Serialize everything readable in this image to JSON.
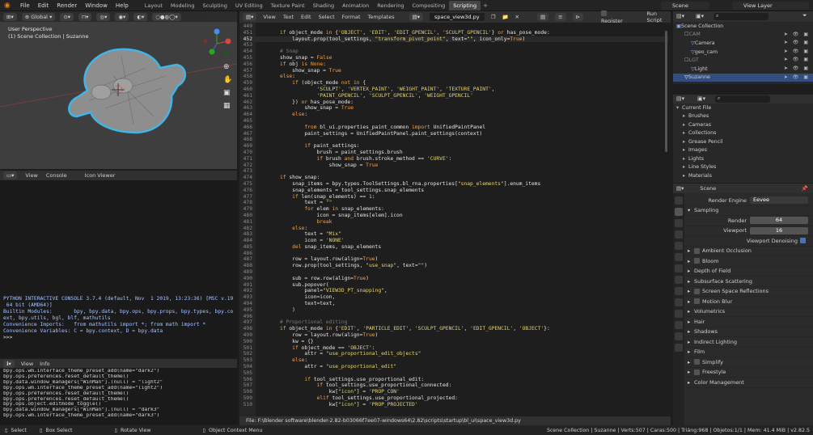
{
  "menu": [
    "File",
    "Edit",
    "Render",
    "Window",
    "Help"
  ],
  "workspaces": [
    "Layout",
    "Modeling",
    "Sculpting",
    "UV Editing",
    "Texture Paint",
    "Shading",
    "Animation",
    "Rendering",
    "Compositing",
    "Scripting"
  ],
  "scene": "Scene",
  "view_layer": "View Layer",
  "viewport": {
    "orientation": "Global",
    "title": "User Perspective",
    "collection": "(1) Scene Collection | Suzanne"
  },
  "console_header": {
    "view": "View",
    "console": "Console",
    "icon_viewer": "Icon Viewer"
  },
  "console_lines": [
    "PYTHON INTERACTIVE CONSOLE 3.7.4 (default, Nov  1 2019, 13:23:36) [MSC v.1916",
    " 64 bit (AMD64)]",
    "",
    "Builtin Modules:       bpy, bpy.data, bpy.ops, bpy.props, bpy.types, bpy.cont",
    "ext, bpy.utils, bgl, blf, mathutils",
    "Convenience Imports:   from mathutils import *; from math import *",
    "Convenience Variables: C = bpy.context, D = bpy.data",
    "",
    ">>> "
  ],
  "info_header": {
    "view": "View",
    "info": "Info"
  },
  "info_lines": [
    "bpy.ops.wm.interface_theme_preset_add(name=\"dark2\")",
    "bpy.ops.preferences.reset_default_theme()",
    "bpy.data.window_managers[\"WinMan\"].(null) = \"light2\"",
    "bpy.ops.wm.interface_theme_preset_add(name=\"light2\")",
    "bpy.ops.preferences.reset_default_theme()",
    "bpy.ops.preferences.reset_default_theme()",
    "bpy.ops.object.editmode_toggle()",
    "bpy.data.window_managers[\"WinMan\"].(null) = \"dark3\"",
    "bpy.ops.wm.interface_theme_preset_add(name=\"dark3\")"
  ],
  "text_editor": {
    "menus": [
      "View",
      "Text",
      "Edit",
      "Select",
      "Format",
      "Templates"
    ],
    "filename": "space_view3d.py",
    "register": "Register",
    "run": "Run Script",
    "footer": "File: F:\\Blender software\\blender-2.82-b03066f7ee07-windows64\\2.82\\scripts\\startup\\bl_ui\\space_view3d.py"
  },
  "code": [
    {
      "n": "449",
      "t": ""
    },
    {
      "n": "451",
      "t": "if object_mode in {'OBJECT', 'EDIT', 'EDIT_GPENCIL', 'SCULPT_GPENCIL'} or has_pose_mode:"
    },
    {
      "n": "452",
      "t": "    layout.prop(tool_settings, \"transform_pivot_point\", text=\"\", icon_only=True)"
    },
    {
      "n": "453",
      "t": ""
    },
    {
      "n": "454",
      "t": "# Snap"
    },
    {
      "n": "455",
      "t": "show_snap = False"
    },
    {
      "n": "456",
      "t": "if obj is None:"
    },
    {
      "n": "457",
      "t": "    show_snap = True"
    },
    {
      "n": "458",
      "t": "else:"
    },
    {
      "n": "459",
      "t": "    if (object_mode not in {"
    },
    {
      "n": "460",
      "t": "            'SCULPT', 'VERTEX_PAINT', 'WEIGHT_PAINT', 'TEXTURE_PAINT',"
    },
    {
      "n": "461",
      "t": "            'PAINT_GPENCIL', 'SCULPT_GPENCIL', 'WEIGHT_GPENCIL'"
    },
    {
      "n": "462",
      "t": "    }) or has_pose_mode:"
    },
    {
      "n": "463",
      "t": "        show_snap = True"
    },
    {
      "n": "464",
      "t": "    else:"
    },
    {
      "n": "465",
      "t": ""
    },
    {
      "n": "466",
      "t": "        from bl_ui.properties_paint_common import UnifiedPaintPanel"
    },
    {
      "n": "467",
      "t": "        paint_settings = UnifiedPaintPanel.paint_settings(context)"
    },
    {
      "n": "468",
      "t": ""
    },
    {
      "n": "469",
      "t": "        if paint_settings:"
    },
    {
      "n": "470",
      "t": "            brush = paint_settings.brush"
    },
    {
      "n": "471",
      "t": "            if brush and brush.stroke_method == 'CURVE':"
    },
    {
      "n": "472",
      "t": "                show_snap = True"
    },
    {
      "n": "473",
      "t": ""
    },
    {
      "n": "474",
      "t": "if show_snap:"
    },
    {
      "n": "475",
      "t": "    snap_items = bpy.types.ToolSettings.bl_rna.properties[\"snap_elements\"].enum_items"
    },
    {
      "n": "476",
      "t": "    snap_elements = tool_settings.snap_elements"
    },
    {
      "n": "477",
      "t": "    if len(snap_elements) == 1:"
    },
    {
      "n": "478",
      "t": "        text = \"\""
    },
    {
      "n": "479",
      "t": "        for elem in snap_elements:"
    },
    {
      "n": "480",
      "t": "            icon = snap_items[elem].icon"
    },
    {
      "n": "481",
      "t": "            break"
    },
    {
      "n": "482",
      "t": "    else:"
    },
    {
      "n": "483",
      "t": "        text = \"Mix\""
    },
    {
      "n": "484",
      "t": "        icon = 'NONE'"
    },
    {
      "n": "485",
      "t": "    del snap_items, snap_elements"
    },
    {
      "n": "486",
      "t": ""
    },
    {
      "n": "487",
      "t": "    row = layout.row(align=True)"
    },
    {
      "n": "488",
      "t": "    row.prop(tool_settings, \"use_snap\", text=\"\")"
    },
    {
      "n": "489",
      "t": ""
    },
    {
      "n": "490",
      "t": "    sub = row.row(align=True)"
    },
    {
      "n": "491",
      "t": "    sub.popover("
    },
    {
      "n": "492",
      "t": "        panel=\"VIEW3D_PT_snapping\","
    },
    {
      "n": "493",
      "t": "        icon=icon,"
    },
    {
      "n": "494",
      "t": "        text=text,"
    },
    {
      "n": "495",
      "t": "    )"
    },
    {
      "n": "496",
      "t": ""
    },
    {
      "n": "497",
      "t": "# Proportional editing"
    },
    {
      "n": "498",
      "t": "if object_mode in {'EDIT', 'PARTICLE_EDIT', 'SCULPT_GPENCIL', 'EDIT_GPENCIL', 'OBJECT'}:"
    },
    {
      "n": "499",
      "t": "    row = layout.row(align=True)"
    },
    {
      "n": "500",
      "t": "    kw = {}"
    },
    {
      "n": "501",
      "t": "    if object_mode == 'OBJECT':"
    },
    {
      "n": "502",
      "t": "        attr = \"use_proportional_edit_objects\""
    },
    {
      "n": "503",
      "t": "    else:"
    },
    {
      "n": "504",
      "t": "        attr = \"use_proportional_edit\""
    },
    {
      "n": "505",
      "t": ""
    },
    {
      "n": "506",
      "t": "        if tool_settings.use_proportional_edit:"
    },
    {
      "n": "507",
      "t": "            if tool_settings.use_proportional_connected:"
    },
    {
      "n": "508",
      "t": "                kw[\"icon\"] = 'PROP_CON'"
    },
    {
      "n": "509",
      "t": "            elif tool_settings.use_proportional_projected:"
    },
    {
      "n": "510",
      "t": "                kw[\"icon\"] = 'PROP_PROJECTED'"
    }
  ],
  "outliner": [
    {
      "label": "Scene Collection",
      "indent": 4
    },
    {
      "label": "CAM",
      "indent": 14,
      "dim": true
    },
    {
      "label": "Camera",
      "indent": 22
    },
    {
      "label": "geo_cam",
      "indent": 22
    },
    {
      "label": "LGT",
      "indent": 14,
      "dim": true
    },
    {
      "label": "Light",
      "indent": 22
    },
    {
      "label": "Suzanne",
      "indent": 14,
      "sel": true
    }
  ],
  "file_browser": {
    "root": "Current File",
    "items": [
      "Brushes",
      "Cameras",
      "Collections",
      "Grease Pencil",
      "Images",
      "Lights",
      "Line Styles",
      "Materials"
    ]
  },
  "properties": {
    "scene_label": "Scene",
    "render_engine_label": "Render Engine",
    "render_engine": "Eevee",
    "sampling": "Sampling",
    "render_label": "Render",
    "render_value": "64",
    "viewport_label": "Viewport",
    "viewport_value": "16",
    "denoising": "Viewport Denoising",
    "panels": [
      {
        "label": "Ambient Occlusion",
        "chk": true
      },
      {
        "label": "Bloom",
        "chk": true
      },
      {
        "label": "Depth of Field",
        "chk": false
      },
      {
        "label": "Subsurface Scattering",
        "chk": false
      },
      {
        "label": "Screen Space Reflections",
        "chk": true
      },
      {
        "label": "Motion Blur",
        "chk": true
      },
      {
        "label": "Volumetrics",
        "chk": false
      },
      {
        "label": "Hair",
        "chk": false
      },
      {
        "label": "Shadows",
        "chk": false
      },
      {
        "label": "Indirect Lighting",
        "chk": false
      },
      {
        "label": "Film",
        "chk": false
      },
      {
        "label": "Simplify",
        "chk": true
      },
      {
        "label": "Freestyle",
        "chk": true
      },
      {
        "label": "Color Management",
        "chk": false
      }
    ]
  },
  "status": {
    "select": "Select",
    "box": "Box Select",
    "rotate": "Rotate View",
    "context": "Object Context Menu",
    "right": "Scene Collection | Suzanne | Verts:507 | Caras:500 | Triáng:968 | Objetos:1/1 | Mem: 41.4 MiB | v2.82.5"
  },
  "colors": {
    "accent": "#e87d0d",
    "selection": "#334d80",
    "header": "#303030"
  }
}
